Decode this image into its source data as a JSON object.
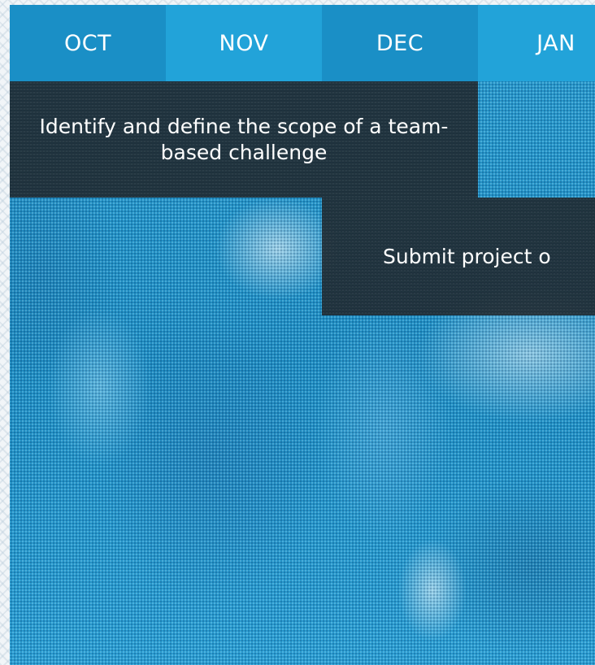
{
  "timeline": {
    "months": [
      "OCT",
      "NOV",
      "DEC",
      "JAN"
    ],
    "tasks": [
      {
        "label": "Identify and define the scope of a team-based challenge"
      },
      {
        "label": "Submit project o"
      }
    ]
  },
  "colors": {
    "month_dark": "#1a8fc6",
    "month_light": "#22a3d9",
    "task_bg": "#1e242a",
    "photo_tint": "#1f96cc"
  }
}
